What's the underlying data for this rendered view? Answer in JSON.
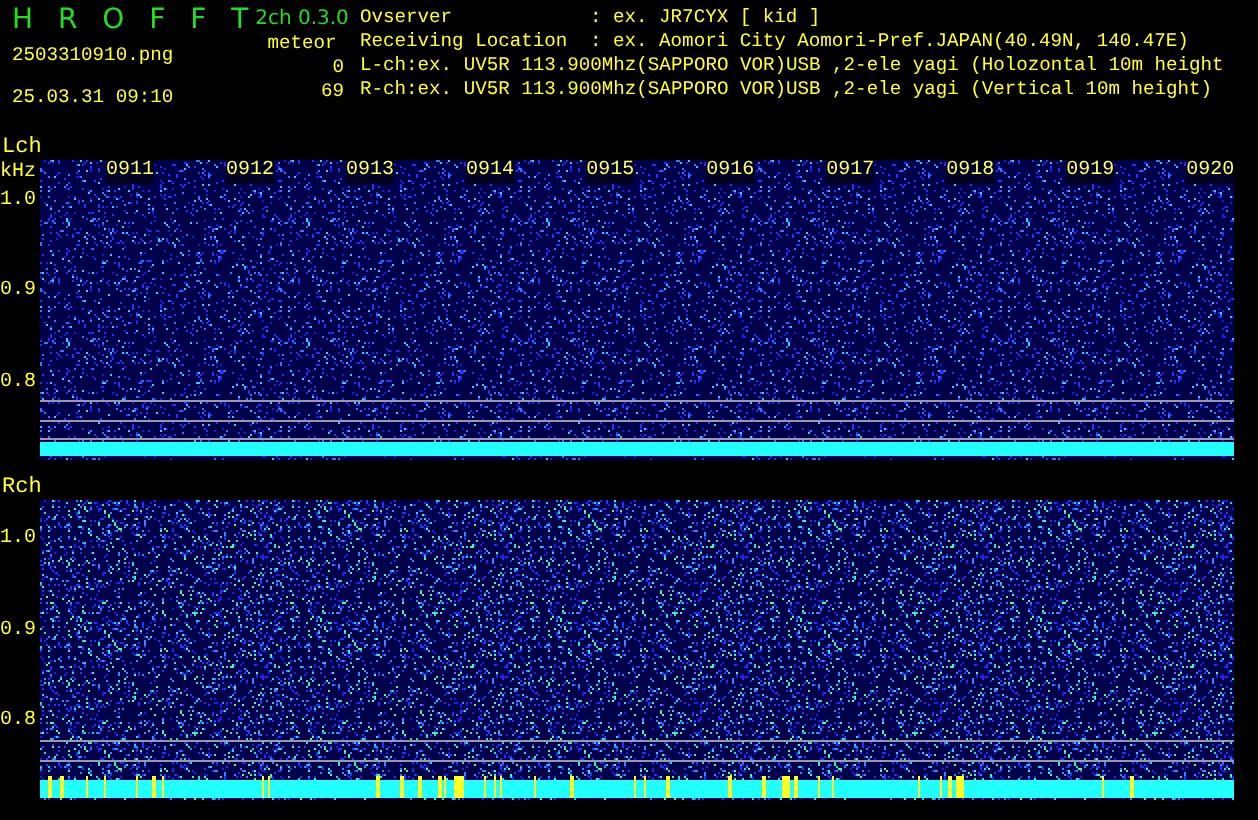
{
  "app": {
    "title": "H R O F F T",
    "version": "2ch 0.3.0",
    "filename": "2503310910.png",
    "timestamp": "25.03.31 09:10"
  },
  "meteor": {
    "label": "meteor",
    "counts": [
      "0",
      "69"
    ]
  },
  "info": [
    {
      "label": "Ovserver",
      "value": ": ex. JR7CYX [ kid ]"
    },
    {
      "label": "Receiving Location",
      "value": ": ex. Aomori City Aomori-Pref.JAPAN(40.49N, 140.47E)"
    }
  ],
  "channels": [
    "L-ch:ex. UV5R 113.900Mhz(SAPPORO VOR)USB ,2-ele yagi (Holozontal 10m height",
    "R-ch:ex. UV5R 113.900Mhz(SAPPORO VOR)USB ,2-ele yagi (Vertical 10m height)"
  ],
  "panels": [
    {
      "label": "Lch",
      "unit": "kHz",
      "yticks": [
        "1.0",
        "0.9",
        "0.8"
      ],
      "time_labels": [
        "0911",
        "0912",
        "0913",
        "0914",
        "0915",
        "0916",
        "0917",
        "0918",
        "0919",
        "0920"
      ],
      "meteor_marks": false
    },
    {
      "label": "Rch",
      "yticks": [
        "1.0",
        "0.9",
        "0.8"
      ],
      "meteor_marks": true
    }
  ]
}
